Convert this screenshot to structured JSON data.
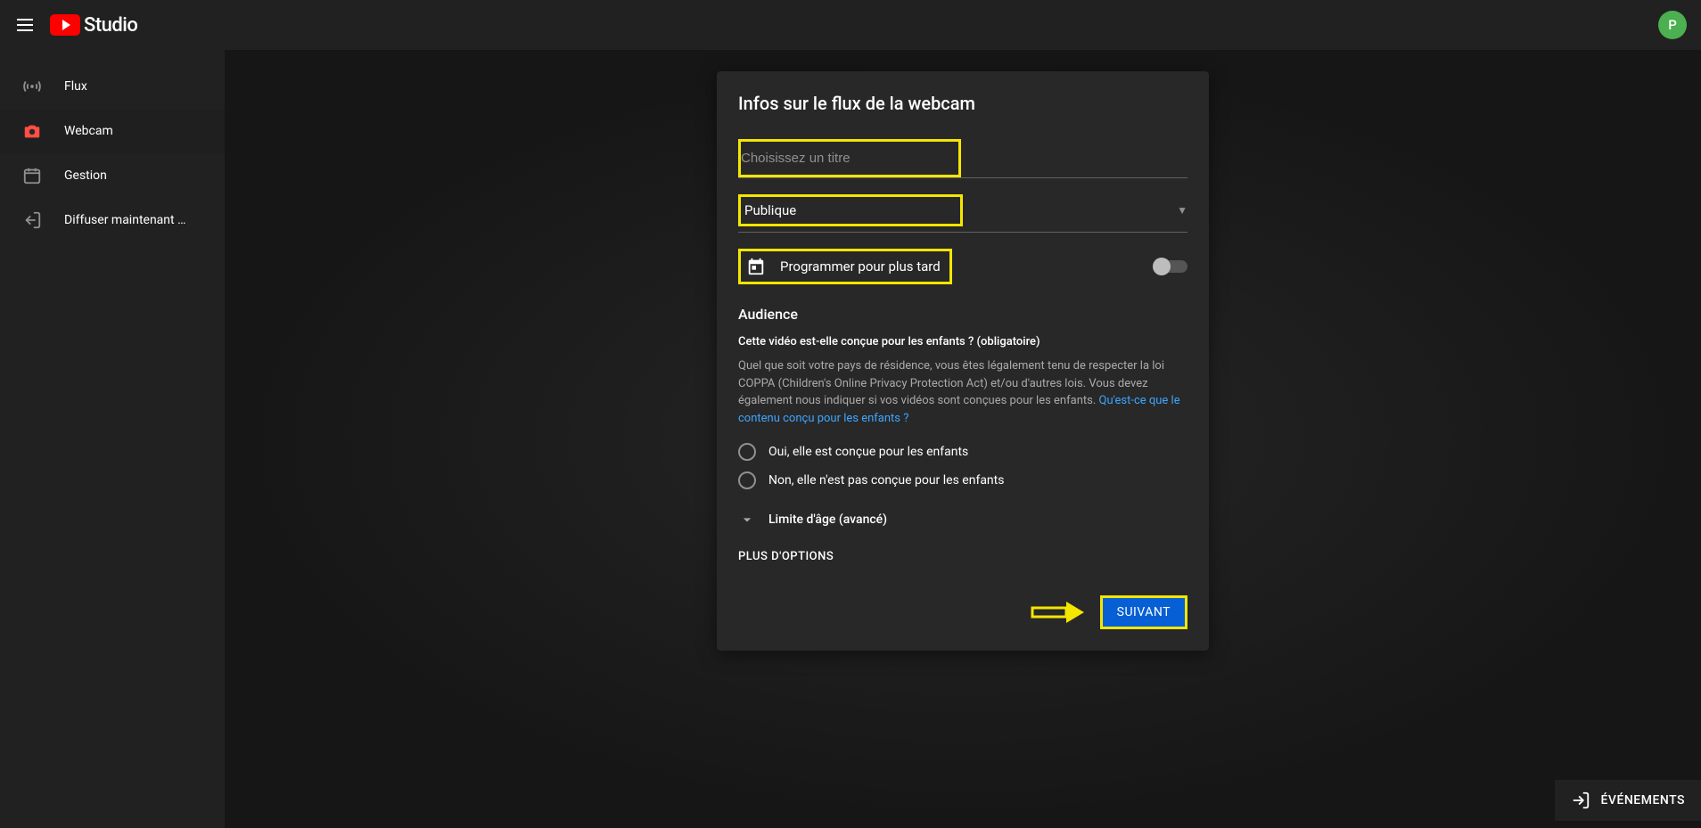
{
  "header": {
    "logo_text": "Studio",
    "avatar_initial": "P"
  },
  "sidebar": {
    "items": [
      {
        "label": "Flux",
        "icon": "broadcast"
      },
      {
        "label": "Webcam",
        "icon": "camera"
      },
      {
        "label": "Gestion",
        "icon": "calendar"
      },
      {
        "label": "Diffuser maintenant …",
        "icon": "exit"
      }
    ]
  },
  "modal": {
    "title": "Infos sur le flux de la webcam",
    "title_placeholder": "Choisissez un titre",
    "visibility_value": "Publique",
    "schedule_label": "Programmer pour plus tard",
    "audience_heading": "Audience",
    "audience_question": "Cette vidéo est-elle conçue pour les enfants ? (obligatoire)",
    "audience_desc": "Quel que soit votre pays de résidence, vous êtes légalement tenu de respecter la loi COPPA (Children's Online Privacy Protection Act) et/ou d'autres lois. Vous devez également nous indiquer si vos vidéos sont conçues pour les enfants. ",
    "audience_link": "Qu'est-ce que le contenu conçu pour les enfants ?",
    "radio_yes": "Oui, elle est conçue pour les enfants",
    "radio_no": "Non, elle n'est pas conçue pour les enfants",
    "age_limit_label": "Limite d'âge (avancé)",
    "more_options": "PLUS D'OPTIONS",
    "next_button": "SUIVANT"
  },
  "events_button": "ÉVÉNEMENTS"
}
